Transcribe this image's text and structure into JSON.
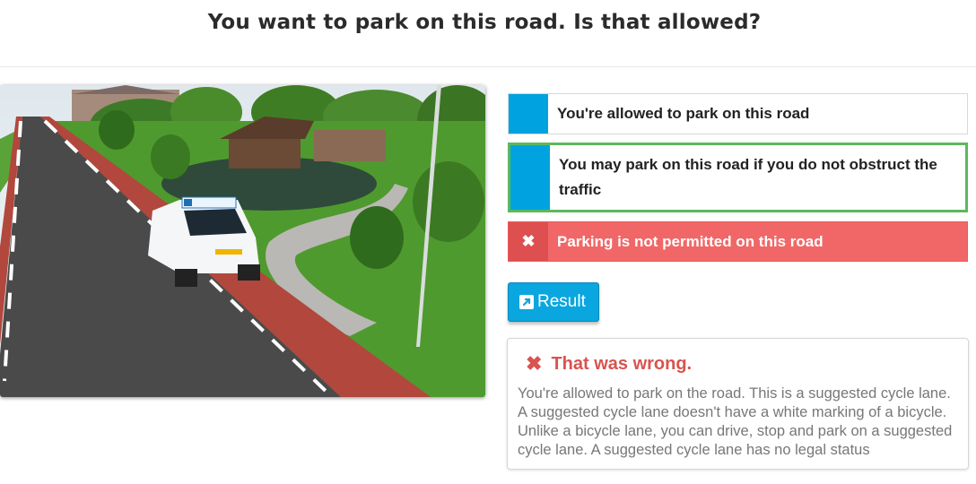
{
  "question": "You want to park on this road. Is that allowed?",
  "answers": [
    {
      "label": "You're allowed to park on this road",
      "state": "neutral"
    },
    {
      "label": "You may park on this road if you do not obstruct the traffic",
      "state": "selected"
    },
    {
      "label": "Parking is not permitted on this road",
      "state": "wrong",
      "icon": "close-icon"
    }
  ],
  "result_button": {
    "label": "Result",
    "icon": "external-link-icon"
  },
  "feedback": {
    "icon": "close-icon",
    "heading": "That was wrong.",
    "body": "You're allowed to park on the road. This is a suggested cycle lane. A suggested cycle lane doesn't have a white marking of a bicycle. Unlike a bicycle lane, you can drive, stop and park on a suggested cycle lane. A suggested cycle lane has no legal status"
  },
  "colors": {
    "accent": "#00a3e0",
    "correct_border": "#5cb85c",
    "wrong": "#f16767",
    "error_text": "#d9534f"
  },
  "image": {
    "alt": "Road scene with suggested cycle lane and driving school car"
  }
}
